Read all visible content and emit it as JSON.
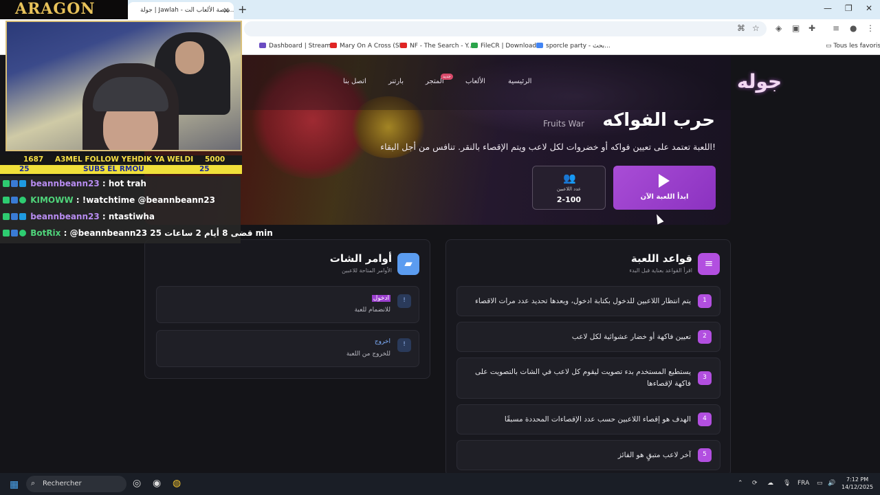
{
  "browser": {
    "tab_title": "جولة | Jawlah - منصة الألعاب الت...",
    "tab_close": "×",
    "new_tab": "+",
    "bookmarks": [
      {
        "label": "Dashboard | Stream...",
        "color": "#6a4cc2"
      },
      {
        "label": "Mary On A Cross (Sl...",
        "color": "#e02424"
      },
      {
        "label": "NF - The Search - Y...",
        "color": "#e02424"
      },
      {
        "label": "FileCR | Download",
        "color": "#2aa44a"
      },
      {
        "label": "sporcle party - بحث...",
        "color": "#4285f4"
      }
    ],
    "all_bookmarks": "Tous les favoris"
  },
  "site": {
    "brand": "جوله",
    "nav": {
      "home": "الرئيسية",
      "games": "الألعاب",
      "store": "المتجر",
      "store_badge": "جديد",
      "partner": "بارتنر",
      "contact": "اتصل بنا"
    },
    "game": {
      "title": "حرب الفواكه",
      "title_en": "Fruits War",
      "description": "اللعبة تعتمد على تعيين فواكه أو خضروات لكل لاعب ويتم الإقصاء بالنقر. تنافس من أجل البقاء!",
      "start_label": "ابدأ اللعبة الآن",
      "players_caption": "عدد اللاعبين",
      "players_value": "2-100"
    },
    "rules": {
      "title": "قواعد اللعبة",
      "subtitle": "اقرأ القواعد بعناية قبل البدء",
      "items": [
        {
          "n": "1",
          "text": "يتم انتظار اللاعبين للدخول بكتابة ادخول، وبعدها تحديد عدد مرات الاقصاء"
        },
        {
          "n": "2",
          "text": "تعيين فاكهة أو خضار عشوائية لكل لاعب"
        },
        {
          "n": "3",
          "text": "يستطيع المستخدم بدء تصويت ليقوم كل لاعب في الشات بالتصويت على فاكهة لإقصاءها"
        },
        {
          "n": "4",
          "text": "الهدف هو إقصاء اللاعبين حسب عدد الإقصاءات المحددة مسبقًا"
        },
        {
          "n": "5",
          "text": "آخر لاعب متبقٍ هو الفائز"
        }
      ]
    },
    "commands": {
      "title": "أوامر الشات",
      "subtitle": "الأوامر المتاحة للاعبين",
      "items": [
        {
          "icon": "!",
          "name": "ادخول",
          "desc": "للانضمام للعبة"
        },
        {
          "icon": "!",
          "name": "اخروج",
          "desc": "للخروج من اللعبة"
        }
      ]
    },
    "colors": {
      "accent": "#9b3fcf",
      "rule_num": "#b24fe0",
      "cmd_icon": "#2a3a5a"
    }
  },
  "overlay": {
    "logo": "ARAGON",
    "banner_top": {
      "left": "1687",
      "center": "A3MEL FOLLOW YEHDIK YA WELDI",
      "right": "5000"
    },
    "banner_bottom": {
      "left": "25",
      "center": "SUBS EL RMOU",
      "right": "25"
    },
    "chat": [
      {
        "user": "beannbeann23",
        "color": "#b78cf0",
        "msg": ": hot trah"
      },
      {
        "user": "KIMOWW",
        "color": "#4fd37a",
        "msg": ": !watchtime @beannbeann23"
      },
      {
        "user": "beannbeann23",
        "color": "#b78cf0",
        "msg": ": ntastiwha"
      },
      {
        "user": "BotRix",
        "color": "#4fd37a",
        "msg": ": @beannbeann23 قضى 8 أيام 2 ساعات 25 min"
      }
    ]
  },
  "taskbar": {
    "search_placeholder": "Rechercher",
    "language": "FRA",
    "time": "7:12 PM",
    "date": "14/12/2025"
  }
}
